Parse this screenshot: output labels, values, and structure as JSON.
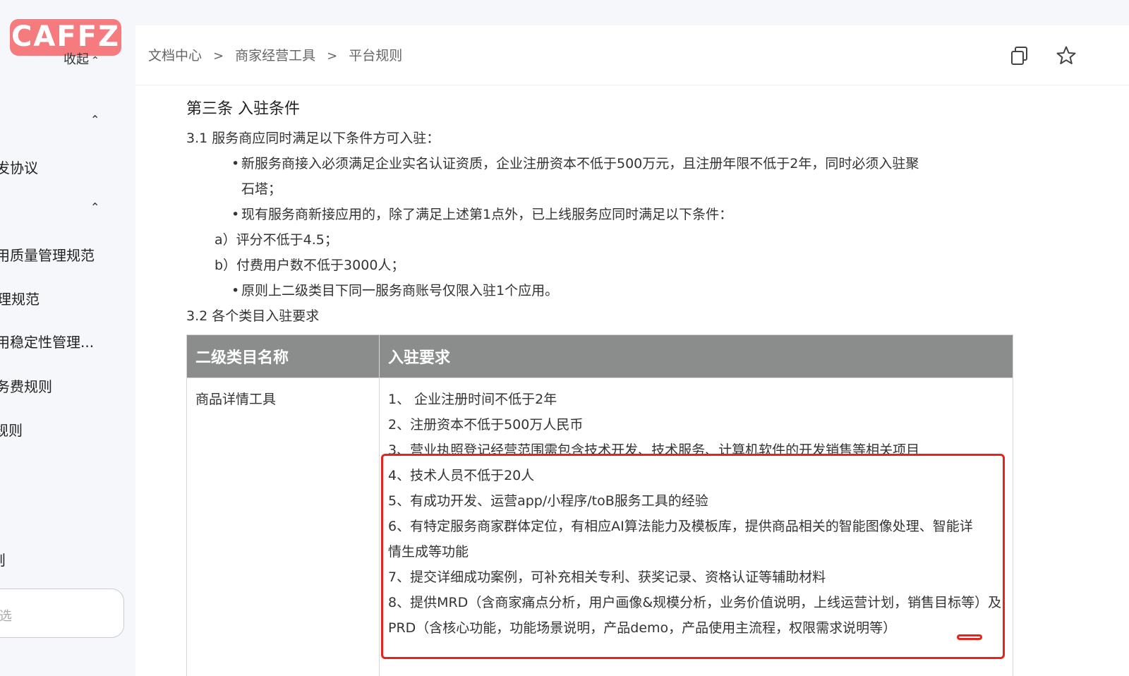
{
  "sidebar": {
    "logo": "CAFFZ",
    "collapse_label": "收起",
    "items": [
      "发协议",
      "用质量管理规范",
      "理规范",
      "用稳定性管理...",
      "务费规则",
      "规则",
      "则"
    ],
    "search_placeholder": "选"
  },
  "header": {
    "breadcrumbs": [
      "文档中心",
      "商家经营工具",
      "平台规则"
    ]
  },
  "article": {
    "heading": "第三条 入驻条件",
    "p31": "3.1 服务商应同时满足以下条件方可入驻：",
    "b1_line1": "新服务商接入必须满足企业实名认证资质，企业注册资本不低于500万元，且注册年限不低于2年，同时必须入驻聚",
    "b1_line2": "石塔；",
    "b2": "现有服务商新接应用的，除了满足上述第1点外，已上线服务应同时满足以下条件：",
    "a": "a）评分不低于4.5；",
    "b": "b）付费用户数不低于3000人；",
    "b3": "原则上二级类目下同一服务商账号仅限入驻1个应用。",
    "p32": "3.2 各个类目入驻要求",
    "table": {
      "headers": [
        "二级类目名称",
        "入驻要求"
      ],
      "category": "商品详情工具",
      "requirements": [
        "1、 企业注册时间不低于2年",
        "2、注册资本不低于500万人民币",
        "3、营业执照登记经营范围需包含技术开发、技术服务、计算机软件的开发销售等相关项目",
        "4、技术人员不低于20人",
        "5、有成功开发、运营app/小程序/toB服务工具的经验",
        "6、有特定服务商家群体定位，有相应AI算法能力及模板库，提供商品相关的智能图像处理、智能详情生成等功能",
        "7、提交详细成功案例，可补充相关专利、获奖记录、资格认证等辅助材料",
        "8、提供MRD（含商家痛点分析，用户画像&规模分析，业务价值说明，上线运营计划，销售目标等）及PRD（含核心功能，功能场景说明，产品demo，产品使用主流程，权限需求说明等）"
      ]
    }
  },
  "colors": {
    "highlight": "#e8221c",
    "table_header": "#8a8d8c",
    "logo": "#f57b7f"
  }
}
